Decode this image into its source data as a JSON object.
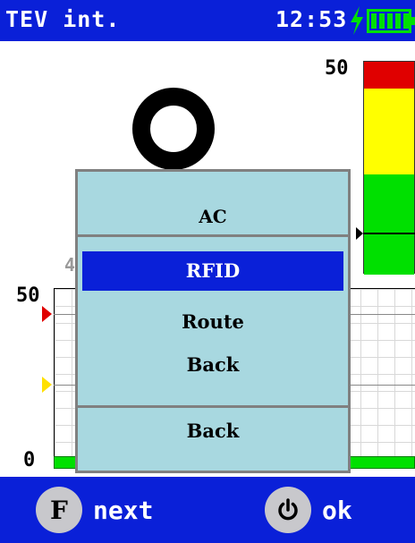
{
  "status_bar": {
    "title": "TEV int.",
    "clock": "12:53",
    "charging_icon": "lightning-bolt",
    "battery_icon": "battery-full",
    "colors": {
      "background": "#0a20d8",
      "text": "#ffffff",
      "battery": "#00e000"
    }
  },
  "level_bar": {
    "max_label": "50",
    "segments": [
      {
        "name": "red",
        "color": "#e00000"
      },
      {
        "name": "yellow",
        "color": "#ffff00"
      },
      {
        "name": "green",
        "color": "#00e000"
      }
    ]
  },
  "chart": {
    "max_label": "50",
    "min_label": "0",
    "faint_label": "4",
    "marker_colors": {
      "alarm": "#e00000",
      "warning": "#ffe000",
      "baseline": "#00e000"
    }
  },
  "dialog": {
    "header": "AC",
    "items": [
      {
        "label": "RFID",
        "selected": true
      },
      {
        "label": "Route",
        "selected": false
      },
      {
        "label": "Back",
        "selected": false
      }
    ],
    "footer": "Back",
    "colors": {
      "background": "#a8d8e0",
      "highlight": "#0a20d8",
      "border": "#808080"
    }
  },
  "bottom_bar": {
    "left_key": {
      "icon_letter": "F",
      "label": "next"
    },
    "right_key": {
      "icon": "power-icon",
      "label": "ok"
    }
  }
}
